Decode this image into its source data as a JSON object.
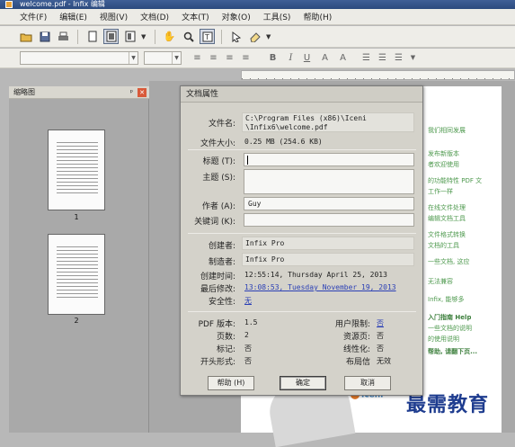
{
  "window": {
    "title": "welcome.pdf - Infix 编辑"
  },
  "menu": [
    "文件(F)",
    "编辑(E)",
    "视图(V)",
    "文档(D)",
    "文本(T)",
    "对象(O)",
    "工具(S)",
    "帮助(H)"
  ],
  "toolbar": {
    "icons": [
      "folder-open-icon",
      "save-icon",
      "print-icon",
      "page-icon",
      "page-layout-icon",
      "page-view-icon",
      "hand-icon",
      "zoom-icon",
      "text-select-icon",
      "pointer-icon",
      "eraser-icon"
    ]
  },
  "format_toolbar": {
    "bold": "B",
    "italic": "I",
    "underline": "U",
    "superscript": "A",
    "subscript": "A"
  },
  "thumbnails": {
    "title": "缩略图",
    "pages": [
      "1",
      "2"
    ]
  },
  "dialog": {
    "title": "文档属性",
    "file_name_label": "文件名:",
    "file_name_line1": "C:\\Program Files (x86)\\Iceni",
    "file_name_line2": "\\Infix6\\welcome.pdf",
    "file_size_label": "文件大小:",
    "file_size": "0.25 MB (254.6 KB)",
    "title_label": "标题 (T):",
    "title_value": "",
    "subject_label": "主题 (S):",
    "subject_value": "",
    "author_label": "作者 (A):",
    "author_value": "Guy",
    "keywords_label": "关键词 (K):",
    "keywords_value": "",
    "creator_label": "创建者:",
    "creator_value": "Infix Pro",
    "producer_label": "制造者:",
    "producer_value": "Infix Pro",
    "created_label": "创建时间:",
    "created_value": "12:55:14, Thursday April 25, 2013",
    "modified_label": "最后修改:",
    "modified_value": "13:08:53, Tuesday November 19, 2013",
    "security_label": "安全性:",
    "security_value": "无",
    "pdf_version_label": "PDF 版本:",
    "pdf_version_value": "1.5",
    "pages_label": "页数:",
    "pages_value": "2",
    "tagged_label": "标记:",
    "tagged_value": "否",
    "open_form_label": "开头形式:",
    "open_form_value": "否",
    "user_restrictions_label": "用户限制:",
    "user_restrictions_value": "否",
    "resources_label": "资源页:",
    "resources_value": "否",
    "linearized_label": "线性化:",
    "linearized_value": "否",
    "layout_label": "布局信",
    "layout_value": "无效",
    "help_button": "帮助 (H)",
    "ok_button": "确定",
    "cancel_button": "取消"
  },
  "document_lines": [
    "我们相同发展",
    "发布新版本",
    "者欢迎使用",
    "的功能特性 PDF 文",
    "工作一样",
    "在线文件处理",
    "编辑文档工具",
    "文件格式转换",
    "文档的工具",
    "一些文档, 这应",
    "无法兼容",
    "Infix, 能够多",
    "入门指南 Help",
    "一些文档的说明",
    "的使用说明",
    "帮助, 请翻下页..."
  ],
  "logo_text": "Iceni",
  "watermark": "最需教育"
}
